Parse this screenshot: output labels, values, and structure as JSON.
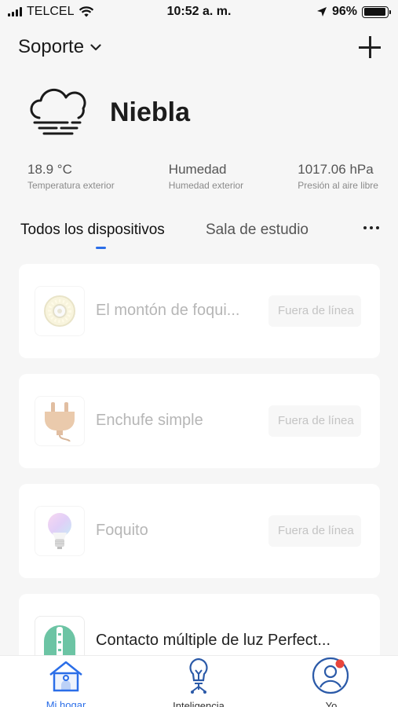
{
  "status_bar": {
    "carrier": "TELCEL",
    "time": "10:52 a. m.",
    "battery": "96%",
    "battery_level": 0.96
  },
  "header": {
    "home_name": "Soporte"
  },
  "weather": {
    "condition": "Niebla",
    "stats": [
      {
        "value": "18.9 °C",
        "label": "Temperatura exterior"
      },
      {
        "value": "Humedad",
        "label": "Humedad exterior"
      },
      {
        "value": "1017.06 hPa",
        "label": "Presión al aire libre"
      }
    ]
  },
  "tabs": {
    "active": "Todos los dispositivos",
    "second": "Sala de estudio"
  },
  "devices": [
    {
      "name": "El montón de foqui...",
      "status": "Fuera de línea",
      "icon": "light-strip-icon",
      "offline": true
    },
    {
      "name": "Enchufe simple",
      "status": "Fuera de línea",
      "icon": "plug-icon",
      "offline": true
    },
    {
      "name": "Foquito",
      "status": "Fuera de línea",
      "icon": "bulb-icon",
      "offline": true
    },
    {
      "name": "Contacto múltiple de luz Perfect...",
      "status": "",
      "icon": "power-strip-icon",
      "offline": false
    }
  ],
  "bottom_nav": {
    "home": "Mi hogar",
    "smart": "Inteligencia",
    "me": "Yo"
  },
  "colors": {
    "accent": "#2b6ee8",
    "notification": "#e8453c"
  }
}
